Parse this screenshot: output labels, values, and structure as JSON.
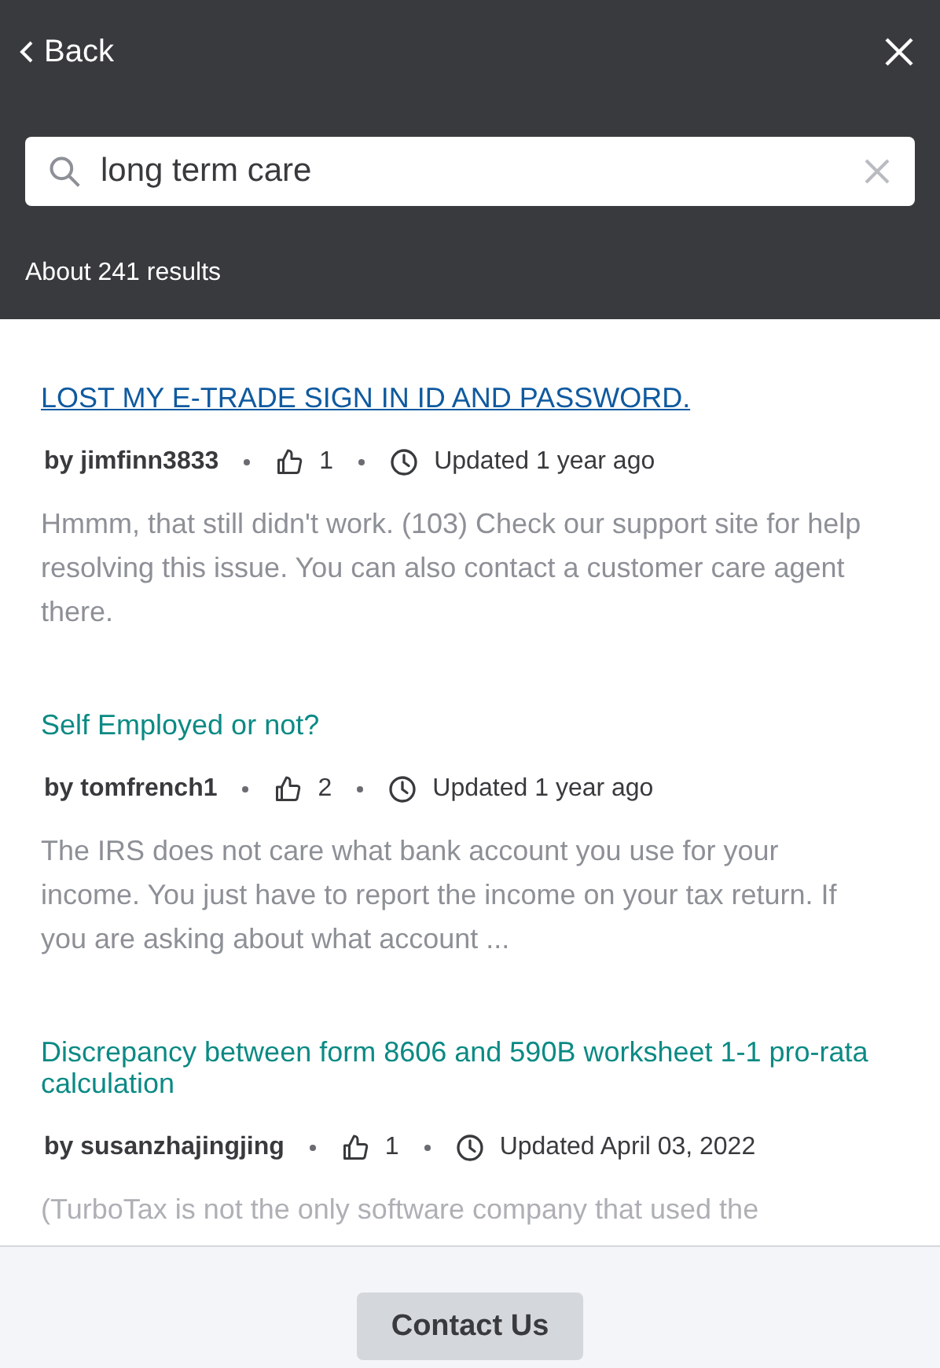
{
  "header": {
    "back": "Back",
    "search": {
      "value": "long term care"
    },
    "result_count": "About 241 results"
  },
  "results": [
    {
      "title": "LOST MY E-TRADE SIGN IN ID AND PASSWORD.",
      "visited": true,
      "author": "by jimfinn3833",
      "likes": "1",
      "updated": "Updated 1 year ago",
      "snippet": "Hmmm, that still didn't work. (103) Check our support site for help resolving this issue. You can also contact a customer care agent there.",
      "faded": false
    },
    {
      "title": "Self Employed or not?",
      "visited": false,
      "author": "by tomfrench1",
      "likes": "2",
      "updated": "Updated 1 year ago",
      "snippet": "The IRS does not care what bank account you use for your income. You just have to report the income on your tax return. If you are asking about what account ...",
      "faded": false
    },
    {
      "title": "Discrepancy between form 8606 and 590B worksheet 1-1 pro-rata calculation",
      "visited": false,
      "author": "by susanzhajingjing",
      "likes": "1",
      "updated": "Updated April 03, 2022",
      "snippet": "(TurboTax is not the only software company that used the",
      "faded": true
    }
  ],
  "footer": {
    "button": "Contact Us"
  }
}
